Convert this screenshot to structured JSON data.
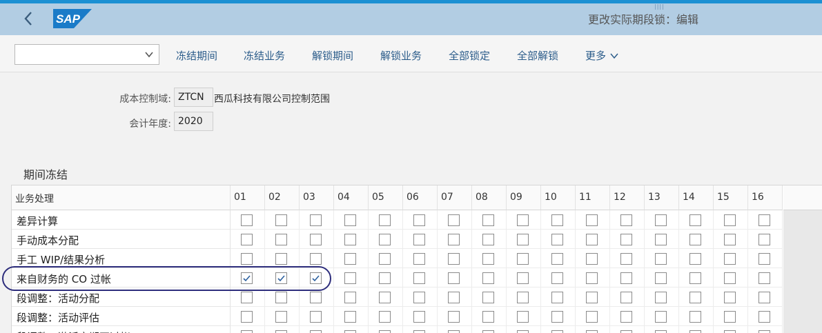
{
  "header": {
    "title": "更改实际期段锁：编辑",
    "logo_text": "SAP",
    "accent": "#1c90d3",
    "bar_color": "#b2cde3",
    "handle_glyph": "||||"
  },
  "toolbar": {
    "dropdown_value": "",
    "buttons": [
      "冻结期间",
      "冻结业务",
      "解锁期间",
      "解锁业务",
      "全部锁定",
      "全部解锁",
      "更多"
    ]
  },
  "fields": {
    "controlling_area_label": "成本控制域:",
    "controlling_area_value": "ZTCN",
    "controlling_area_desc": "西瓜科技有限公司控制范围",
    "fiscal_year_label": "会计年度:",
    "fiscal_year_value": "2020"
  },
  "section_title": "期间冻结",
  "table": {
    "first_header": "业务处理",
    "periods": [
      "01",
      "02",
      "03",
      "04",
      "05",
      "06",
      "07",
      "08",
      "09",
      "10",
      "11",
      "12",
      "13",
      "14",
      "15",
      "16"
    ],
    "rows": [
      {
        "label": "差异计算",
        "checked": []
      },
      {
        "label": "手动成本分配",
        "checked": []
      },
      {
        "label": "手工 WIP/结果分析",
        "checked": []
      },
      {
        "label": "来自财务的 CO 过帐",
        "checked": [
          0,
          1,
          2
        ]
      },
      {
        "label": "段调整：活动分配",
        "checked": []
      },
      {
        "label": "段调整：活动评估",
        "checked": []
      },
      {
        "label": "段调整：激活定期再过帐",
        "checked": []
      }
    ]
  }
}
